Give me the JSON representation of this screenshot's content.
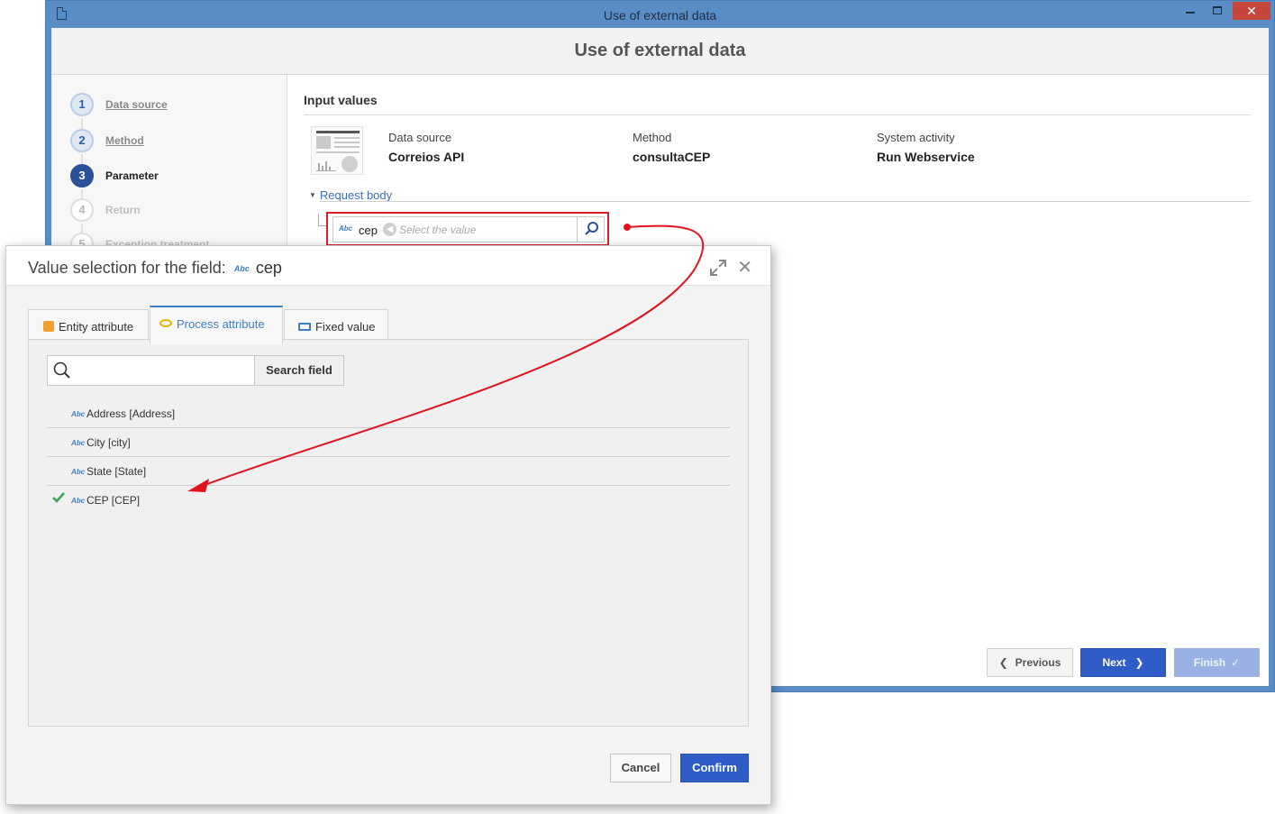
{
  "window": {
    "title": "Use of external data",
    "close_glyph": "✕"
  },
  "page": {
    "title": "Use of external data"
  },
  "steps": [
    {
      "num": "1",
      "label": "Data source",
      "state": "done"
    },
    {
      "num": "2",
      "label": "Method",
      "state": "done"
    },
    {
      "num": "3",
      "label": "Parameter",
      "state": "active"
    },
    {
      "num": "4",
      "label": "Return",
      "state": "todo"
    },
    {
      "num": "5",
      "label": "Exception treatment",
      "state": "todo"
    }
  ],
  "content": {
    "section_title": "Input values",
    "data_source": {
      "label": "Data source",
      "value": "Correios API"
    },
    "method": {
      "label": "Method",
      "value": "consultaCEP"
    },
    "system_activity": {
      "label": "System activity",
      "value": "Run Webservice"
    },
    "request_body_label": "Request body",
    "field": {
      "type_icon": "Abc",
      "name": "cep",
      "placeholder": "Select the value"
    }
  },
  "buttons": {
    "previous": "Previous",
    "next": "Next",
    "finish": "Finish"
  },
  "modal": {
    "title_prefix": "Value selection for the field:",
    "title_icon": "Abc",
    "title_field": "cep",
    "close_glyph": "✕",
    "tabs": [
      {
        "label": "Entity attribute",
        "icon": "entity-icon",
        "active": false
      },
      {
        "label": "Process attribute",
        "icon": "eye-icon",
        "active": true
      },
      {
        "label": "Fixed value",
        "icon": "keyboard-icon",
        "active": false
      }
    ],
    "search": {
      "value": "",
      "button": "Search field"
    },
    "attributes": [
      {
        "icon": "Abc",
        "label": "Address [Address]",
        "selected": false
      },
      {
        "icon": "Abc",
        "label": "City [city]",
        "selected": false
      },
      {
        "icon": "Abc",
        "label": "State [State]",
        "selected": false
      },
      {
        "icon": "Abc",
        "label": "CEP [CEP]",
        "selected": true
      }
    ],
    "cancel": "Cancel",
    "confirm": "Confirm"
  },
  "colors": {
    "window_frame": "#5a8dc5",
    "primary_button": "#2f5cc7",
    "annotation": "#e0141e",
    "check": "#3aa655"
  }
}
